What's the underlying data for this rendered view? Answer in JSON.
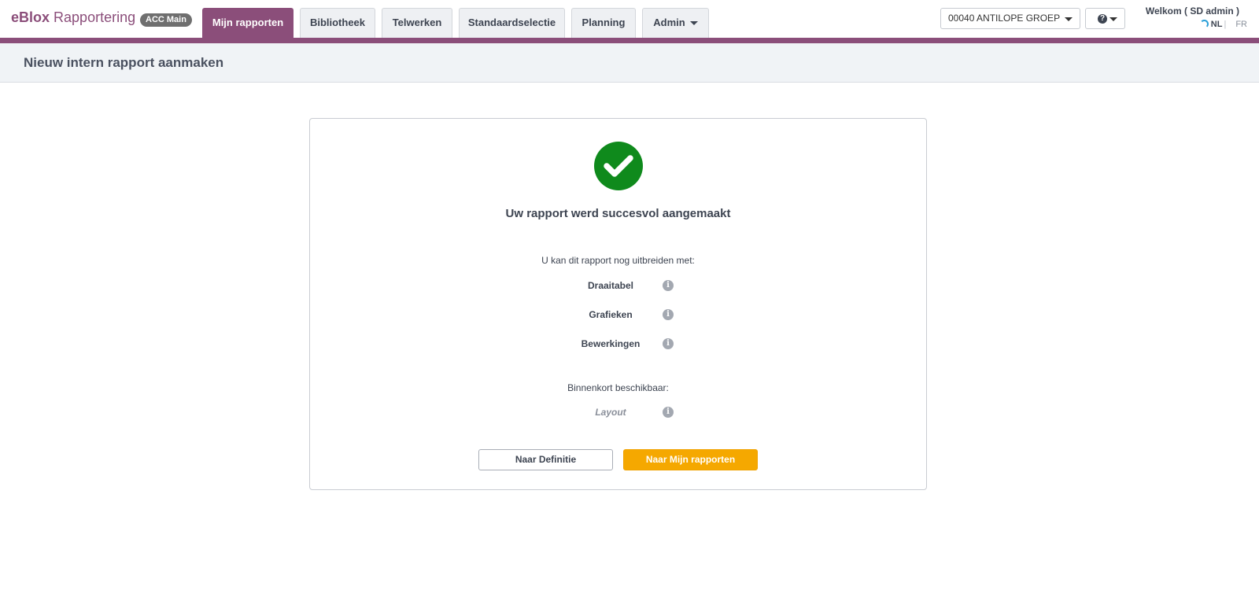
{
  "brand": {
    "name_strong": "eBlox",
    "name_rest": " Rapportering",
    "env_badge": "ACC Main"
  },
  "nav": {
    "tabs": [
      {
        "label": "Mijn rapporten",
        "active": true
      },
      {
        "label": "Bibliotheek",
        "active": false
      },
      {
        "label": "Telwerken",
        "active": false
      },
      {
        "label": "Standaardselectie",
        "active": false
      },
      {
        "label": "Planning",
        "active": false
      },
      {
        "label": "Admin",
        "active": false,
        "dropdown": true
      }
    ]
  },
  "company_selector": {
    "value": "00040 ANTILOPE GROEP"
  },
  "help_menu": {
    "icon": "question-circle-icon"
  },
  "user": {
    "welcome": "Welkom ( SD admin )"
  },
  "language": {
    "current": "NL",
    "separator": "|",
    "other": "FR"
  },
  "page": {
    "title": "Nieuw intern rapport aanmaken"
  },
  "result": {
    "icon": "check-circle-icon",
    "message": "Uw rapport werd succesvol aangemaakt",
    "extend_intro": "U kan dit rapport nog uitbreiden met:",
    "options": [
      {
        "label": "Draaitabel"
      },
      {
        "label": "Grafieken"
      },
      {
        "label": "Bewerkingen"
      }
    ],
    "coming_soon_intro": "Binnenkort beschikbaar:",
    "coming_soon_options": [
      {
        "label": "Layout"
      }
    ]
  },
  "actions": {
    "secondary_label": "Naar Definitie",
    "primary_label": "Naar Mijn rapporten"
  },
  "colors": {
    "brand": "#8b4e7a",
    "success": "#0f8a1c",
    "primary_button": "#f5a800",
    "info_icon": "#a3a8b1"
  }
}
